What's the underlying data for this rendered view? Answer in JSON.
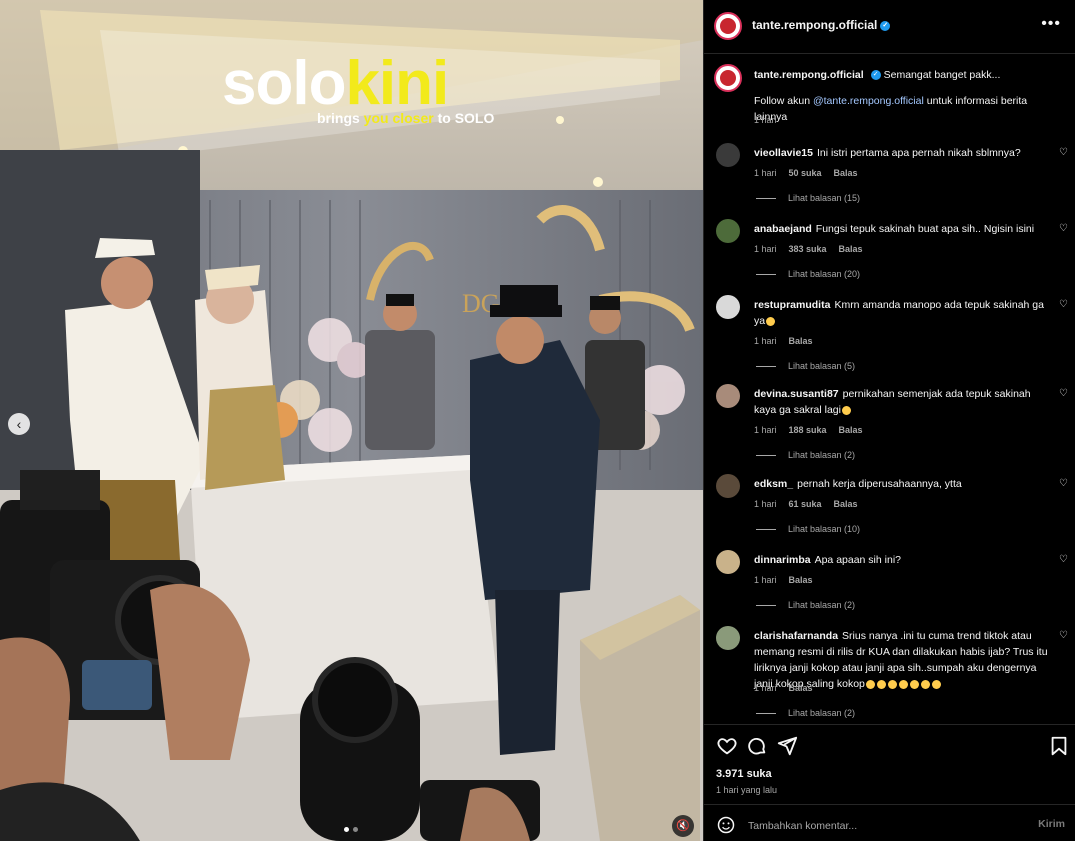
{
  "media": {
    "watermark_part1": "solo",
    "watermark_part2": "kini",
    "tagline_part1": "brings ",
    "tagline_part2": "you closer",
    "tagline_part3": " to SOLO",
    "prev_icon": "chevron-left-icon",
    "mute_icon": "speaker-muted-icon",
    "carousel_dots": 2
  },
  "header": {
    "username": "tante.rempong.official",
    "verified": true,
    "more_icon": "more-horizontal-icon"
  },
  "caption": {
    "username": "tante.rempong.official",
    "text": "Semangat banget pakk...",
    "follow_prefix": "Follow akun ",
    "follow_link": "@tante.rempong.official",
    "follow_suffix": " untuk informasi berita lainnya",
    "time": "1 hari"
  },
  "comments": [
    {
      "username": "vieollavie15",
      "text": "Ini istri pertama apa pernah nikah sblmnya?",
      "time": "1 hari",
      "likes": "50 suka",
      "reply": "Balas",
      "view_replies": "Lihat balasan (15)",
      "avatar_color": "#3a3a3a"
    },
    {
      "username": "anabaejand",
      "text": "Fungsi tepuk sakinah buat apa sih.. Ngisin isini",
      "time": "1 hari",
      "likes": "383 suka",
      "reply": "Balas",
      "view_replies": "Lihat balasan (20)",
      "avatar_color": "#4d6b3a"
    },
    {
      "username": "restupramudita",
      "text": "Kmrn amanda manopo ada tepuk sakinah ga ya",
      "emoji_count": 1,
      "time": "1 hari",
      "likes": "",
      "reply": "Balas",
      "view_replies": "Lihat balasan (5)",
      "avatar_color": "#d9d9d9"
    },
    {
      "username": "devina.susanti87",
      "text": "pernikahan semenjak ada tepuk sakinah kaya ga sakral lagi",
      "emoji_count": 1,
      "time": "1 hari",
      "likes": "188 suka",
      "reply": "Balas",
      "view_replies": "Lihat balasan (2)",
      "avatar_color": "#a88b7a"
    },
    {
      "username": "edksm_",
      "text": "pernah kerja diperusahaannya, ytta",
      "time": "1 hari",
      "likes": "61 suka",
      "reply": "Balas",
      "view_replies": "Lihat balasan (10)",
      "avatar_color": "#5a4a3a"
    },
    {
      "username": "dinnarimba",
      "text": "Apa apaan sih ini?",
      "time": "1 hari",
      "likes": "",
      "reply": "Balas",
      "view_replies": "Lihat balasan (2)",
      "avatar_color": "#c9b28a"
    },
    {
      "username": "clarishafarnanda",
      "text": "Srius nanya .ini tu cuma trend tiktok atau memang resmi di rilis dr KUA dan dilakukan habis ijab? Trus itu liriknya janji kokop atau janji apa sih..sumpah aku dengernya janji kokop saling kokop",
      "emoji_count": 7,
      "time": "1 hari",
      "likes": "",
      "reply": "Balas",
      "view_replies": "Lihat balasan (2)",
      "avatar_color": "#8a9a7a"
    }
  ],
  "actions": {
    "like_icon": "heart-icon",
    "comment_icon": "comment-icon",
    "share_icon": "share-icon",
    "save_icon": "bookmark-icon",
    "likes": "3.971 suka",
    "posted": "1 hari yang lalu"
  },
  "composer": {
    "emoji_icon": "emoji-icon",
    "placeholder": "Tambahkan komentar...",
    "post_label": "Kirim"
  },
  "colors": {
    "accent": "#1f9bf0",
    "story_ring": "#d8305a",
    "brand_yellow": "#f2ea1b"
  }
}
